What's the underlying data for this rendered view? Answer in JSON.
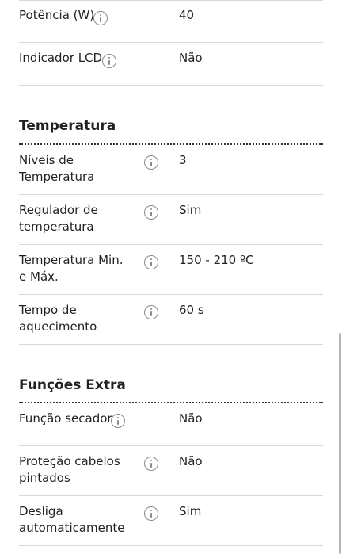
{
  "rows_top": [
    {
      "label": "Potência (W)",
      "value": "40"
    },
    {
      "label": "Indicador LCD",
      "value": "Não"
    }
  ],
  "sections": [
    {
      "title": "Temperatura",
      "rows": [
        {
          "label": "Níveis de Temperatura",
          "value": "3"
        },
        {
          "label": "Regulador de temperatura",
          "value": "Sim"
        },
        {
          "label": "Temperatura Min. e Máx.",
          "value": "150 - 210 ºC"
        },
        {
          "label": "Tempo de aquecimento",
          "value": "60 s"
        }
      ]
    },
    {
      "title": "Funções Extra",
      "rows": [
        {
          "label": "Função secador",
          "value": "Não"
        },
        {
          "label": "Proteção cabelos pintados",
          "value": "Não"
        },
        {
          "label": "Desliga automaticamente",
          "value": "Sim"
        }
      ]
    }
  ],
  "icons": {
    "info": "info-icon"
  }
}
